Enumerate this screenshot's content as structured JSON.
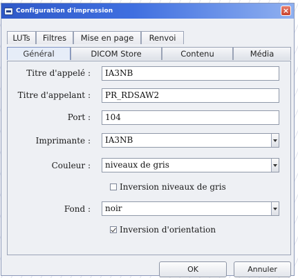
{
  "window": {
    "title": "Configuration d'impression",
    "close_label": "×"
  },
  "tabs_row1": [
    {
      "label": "LUTs"
    },
    {
      "label": "Filtres"
    },
    {
      "label": "Mise en page"
    },
    {
      "label": "Renvoi"
    }
  ],
  "tabs_row2": [
    {
      "label": "Général",
      "active": true
    },
    {
      "label": "DICOM Store"
    },
    {
      "label": "Contenu"
    },
    {
      "label": "Média"
    }
  ],
  "form": {
    "called_title_label": "Titre d'appelé :",
    "called_title_value": "IA3NB",
    "calling_title_label": "Titre d'appelant :",
    "calling_title_value": "PR_RDSAW2",
    "port_label": "Port :",
    "port_value": "104",
    "printer_label": "Imprimante :",
    "printer_value": "IA3NB",
    "color_label": "Couleur :",
    "color_value": "niveaux de gris",
    "invert_gray_label": "Inversion niveaux de gris",
    "invert_gray_checked": false,
    "background_label": "Fond :",
    "background_value": "noir",
    "invert_orientation_label": "Inversion d'orientation",
    "invert_orientation_checked": true
  },
  "buttons": {
    "ok_label": "OK",
    "cancel_label": "Annuler"
  }
}
